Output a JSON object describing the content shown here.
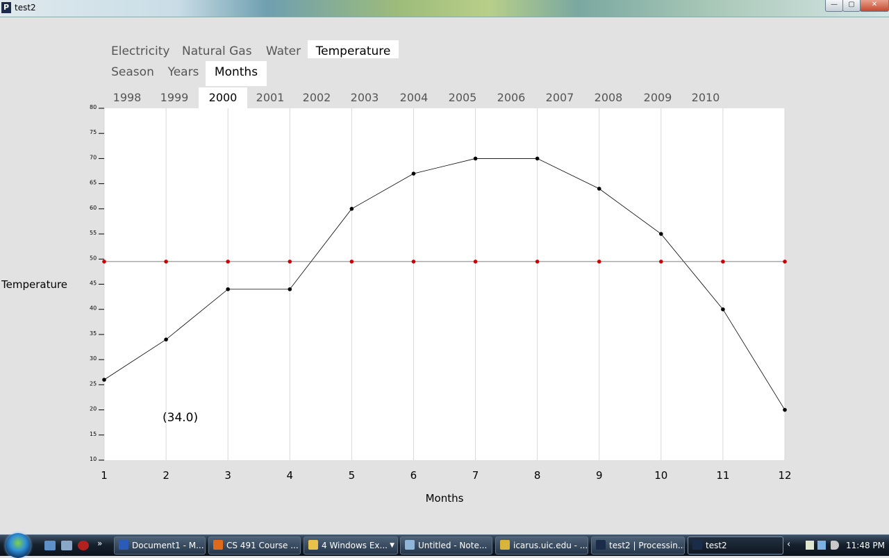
{
  "window": {
    "title": "test2",
    "icon_letter": "P",
    "min_label": "—",
    "max_label": "▢",
    "close_label": "✕"
  },
  "nav": {
    "categories": [
      {
        "label": "Electricity"
      },
      {
        "label": "Natural Gas"
      },
      {
        "label": "Water"
      },
      {
        "label": "Temperature",
        "active": true
      }
    ],
    "periods": [
      {
        "label": "Season"
      },
      {
        "label": "Years"
      },
      {
        "label": "Months",
        "active": true
      }
    ],
    "years": [
      {
        "label": "1998"
      },
      {
        "label": "1999"
      },
      {
        "label": "2000",
        "active": true
      },
      {
        "label": "2001"
      },
      {
        "label": "2002"
      },
      {
        "label": "2003"
      },
      {
        "label": "2004"
      },
      {
        "label": "2005"
      },
      {
        "label": "2006"
      },
      {
        "label": "2007"
      },
      {
        "label": "2008"
      },
      {
        "label": "2009"
      },
      {
        "label": "2010"
      }
    ]
  },
  "chart_data": {
    "type": "line",
    "title": "",
    "xlabel": "Months",
    "ylabel": "Temperature",
    "x": [
      1,
      2,
      3,
      4,
      5,
      6,
      7,
      8,
      9,
      10,
      11,
      12
    ],
    "xlim": [
      1,
      12
    ],
    "ylim": [
      10,
      80
    ],
    "y_ticks": [
      10,
      15,
      20,
      25,
      30,
      35,
      40,
      45,
      50,
      55,
      60,
      65,
      70,
      75,
      80
    ],
    "series": [
      {
        "values": [
          26,
          34,
          44,
          44,
          60,
          67,
          70,
          70,
          64,
          55,
          40,
          20
        ],
        "color": "#000000"
      },
      {
        "values": [
          49.5,
          49.5,
          49.5,
          49.5,
          49.5,
          49.5,
          49.5,
          49.5,
          49.5,
          49.5,
          49.5,
          49.5
        ],
        "color": "#cc0000"
      }
    ],
    "grid": "vertical",
    "readout": "(34.0)"
  },
  "taskbar": {
    "buttons": [
      {
        "label": "Document1 - M...",
        "icon_color": "#2a5bb8",
        "icon": "word-icon"
      },
      {
        "label": "CS 491 Course ...",
        "icon_color": "#e06a1c",
        "icon": "firefox-icon"
      },
      {
        "label": "4 Windows Ex...",
        "icon_color": "#e8c24a",
        "icon": "folder-icon",
        "has_menu": true
      },
      {
        "label": "Untitled - Note...",
        "icon_color": "#8fb6d8",
        "icon": "notepad-icon"
      },
      {
        "label": "icarus.uic.edu - ...",
        "icon_color": "#d9b43a",
        "icon": "ftp-icon"
      },
      {
        "label": "test2 | Processin...",
        "icon_color": "#1b2b4a",
        "icon": "processing-icon"
      },
      {
        "label": "test2",
        "icon_color": "#1b2b4a",
        "icon": "processing-icon",
        "active": true
      }
    ],
    "clock": "11:48 PM",
    "tray_arrow": "‹"
  }
}
